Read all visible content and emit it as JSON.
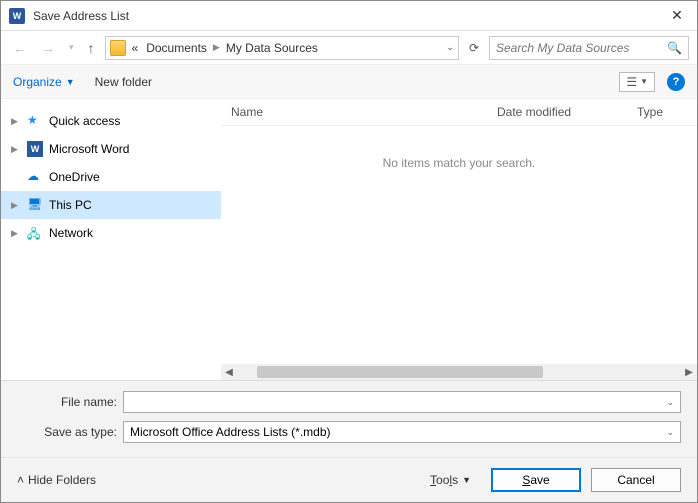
{
  "titlebar": {
    "title": "Save Address List"
  },
  "nav": {
    "crumb_prefix": "«",
    "crumb1": "Documents",
    "crumb2": "My Data Sources"
  },
  "search": {
    "placeholder": "Search My Data Sources"
  },
  "toolbar": {
    "organize": "Organize",
    "newfolder": "New folder"
  },
  "sidebar": {
    "quick": "Quick access",
    "word": "Microsoft Word",
    "onedrive": "OneDrive",
    "thispc": "This PC",
    "network": "Network"
  },
  "columns": {
    "name": "Name",
    "date": "Date modified",
    "type": "Type"
  },
  "empty": "No items match your search.",
  "form": {
    "filename_label": "File name:",
    "filename_value": "",
    "saveas_label": "Save as type:",
    "saveas_value": "Microsoft Office Address Lists (*.mdb)"
  },
  "footer": {
    "hide": "Hide Folders",
    "tools": "Tools",
    "save": "Save",
    "cancel": "Cancel"
  }
}
